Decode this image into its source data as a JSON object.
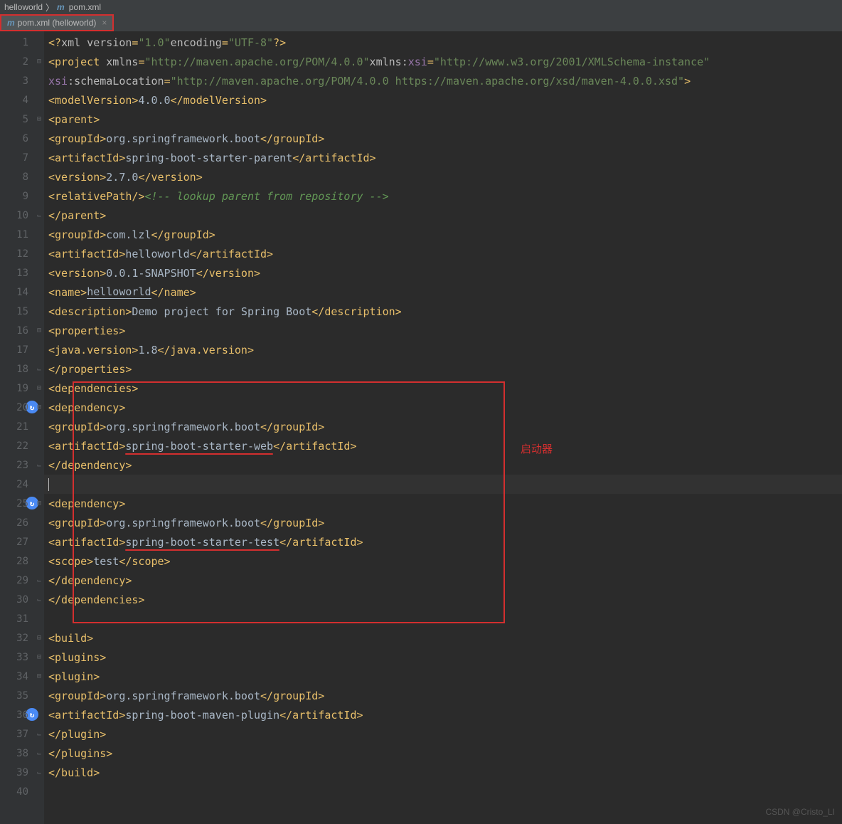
{
  "breadcrumb": {
    "project": "helloworld",
    "file": "pom.xml"
  },
  "tab": {
    "label": "pom.xml (helloworld)"
  },
  "annotation": "启动器",
  "watermark": "CSDN @Cristo_LI",
  "lines": [
    {
      "n": 1,
      "html": "<span class='tag'>&lt;?</span><span class='attr'>xml version</span><span class='tag'>=</span><span class='str'>\"1.0\"</span> <span class='attr'>encoding</span><span class='tag'>=</span><span class='str'>\"UTF-8\"</span><span class='tag'>?&gt;</span>"
    },
    {
      "n": 2,
      "html": "<span class='tag'>&lt;project </span><span class='attr'>xmlns</span><span class='tag'>=</span><span class='str'>\"http://maven.apache.org/POM/4.0.0\"</span> <span class='attr'>xmlns:</span><span class='ns'>xsi</span><span class='tag'>=</span><span class='str'>\"http://www.w3.org/2001/XMLSchema-instance\"</span>"
    },
    {
      "n": 3,
      "html": "         <span class='ns'>xsi</span><span class='attr'>:schemaLocation</span><span class='tag'>=</span><span class='str'>\"http://maven.apache.org/POM/4.0.0 https://maven.apache.org/xsd/maven-4.0.0.xsd\"</span><span class='tag'>&gt;</span>"
    },
    {
      "n": 4,
      "html": "    <span class='tag'>&lt;modelVersion&gt;</span><span class='txt'>4.0.0</span><span class='tag'>&lt;/modelVersion&gt;</span>"
    },
    {
      "n": 5,
      "html": "    <span class='tag'>&lt;parent&gt;</span>"
    },
    {
      "n": 6,
      "html": "        <span class='tag'>&lt;groupId&gt;</span><span class='txt'>org.springframework.boot</span><span class='tag'>&lt;/groupId&gt;</span>"
    },
    {
      "n": 7,
      "html": "        <span class='tag'>&lt;artifactId&gt;</span><span class='txt'>spring-boot-starter-parent</span><span class='tag'>&lt;/artifactId&gt;</span>"
    },
    {
      "n": 8,
      "html": "        <span class='tag'>&lt;version&gt;</span><span class='txt'>2.7.0</span><span class='tag'>&lt;/version&gt;</span>"
    },
    {
      "n": 9,
      "html": "        <span class='tag'>&lt;relativePath/&gt;</span> <span class='comment'>&lt;!-- lookup parent from repository --&gt;</span>"
    },
    {
      "n": 10,
      "html": "    <span class='tag'>&lt;/parent&gt;</span>"
    },
    {
      "n": 11,
      "html": "    <span class='tag'>&lt;groupId&gt;</span><span class='txt'>com.lzl</span><span class='tag'>&lt;/groupId&gt;</span>"
    },
    {
      "n": 12,
      "html": "    <span class='tag'>&lt;artifactId&gt;</span><span class='txt'>helloworld</span><span class='tag'>&lt;/artifactId&gt;</span>"
    },
    {
      "n": 13,
      "html": "    <span class='tag'>&lt;version&gt;</span><span class='txt'>0.0.1-SNAPSHOT</span><span class='tag'>&lt;/version&gt;</span>"
    },
    {
      "n": 14,
      "html": "    <span class='tag'>&lt;name&gt;</span><span class='txt underline-link'>helloworld</span><span class='tag'>&lt;/name&gt;</span>"
    },
    {
      "n": 15,
      "html": "    <span class='tag'>&lt;description&gt;</span><span class='txt'>Demo project for Spring Boot</span><span class='tag'>&lt;/description&gt;</span>"
    },
    {
      "n": 16,
      "html": "    <span class='tag'>&lt;properties&gt;</span>"
    },
    {
      "n": 17,
      "html": "        <span class='tag'>&lt;java.version&gt;</span><span class='txt'>1.8</span><span class='tag'>&lt;/java.version&gt;</span>"
    },
    {
      "n": 18,
      "html": "    <span class='tag'>&lt;/properties&gt;</span>"
    },
    {
      "n": 19,
      "html": "    <span class='tag'>&lt;dependencies&gt;</span>"
    },
    {
      "n": 20,
      "html": "        <span class='tag'>&lt;dependency&gt;</span>",
      "icon": true
    },
    {
      "n": 21,
      "html": "            <span class='tag'>&lt;groupId&gt;</span><span class='txt'>org.springframework.boot</span><span class='tag'>&lt;/groupId&gt;</span>"
    },
    {
      "n": 22,
      "html": "            <span class='tag'>&lt;artifactId&gt;</span><span class='txt red-underline'>spring-boot-starter-web</span><span class='tag'>&lt;/artifactId&gt;</span>"
    },
    {
      "n": 23,
      "html": "        <span class='tag'>&lt;/dependency&gt;</span>"
    },
    {
      "n": 24,
      "html": "<span class='caret'></span>",
      "current": true
    },
    {
      "n": 25,
      "html": "        <span class='tag'>&lt;dependency&gt;</span>",
      "icon": true
    },
    {
      "n": 26,
      "html": "            <span class='tag'>&lt;groupId&gt;</span><span class='txt'>org.springframework.boot</span><span class='tag'>&lt;/groupId&gt;</span>"
    },
    {
      "n": 27,
      "html": "            <span class='tag'>&lt;artifactId&gt;</span><span class='txt red-underline'>spring-boot-starter-test</span><span class='tag'>&lt;/artifactId&gt;</span>"
    },
    {
      "n": 28,
      "html": "            <span class='tag'>&lt;scope&gt;</span><span class='txt'>test</span><span class='tag'>&lt;/scope&gt;</span>"
    },
    {
      "n": 29,
      "html": "        <span class='tag'>&lt;/dependency&gt;</span>"
    },
    {
      "n": 30,
      "html": "    <span class='tag'>&lt;/dependencies&gt;</span>"
    },
    {
      "n": 31,
      "html": ""
    },
    {
      "n": 32,
      "html": "    <span class='tag'>&lt;build&gt;</span>"
    },
    {
      "n": 33,
      "html": "        <span class='tag'>&lt;plugins&gt;</span>"
    },
    {
      "n": 34,
      "html": "            <span class='tag'>&lt;plugin&gt;</span>"
    },
    {
      "n": 35,
      "html": "                <span class='tag'>&lt;groupId&gt;</span><span class='txt'>org.springframework.boot</span><span class='tag'>&lt;/groupId&gt;</span>"
    },
    {
      "n": 36,
      "html": "                <span class='tag'>&lt;artifactId&gt;</span><span class='txt'>spring-boot-maven-plugin</span><span class='tag'>&lt;/artifactId&gt;</span>",
      "icon": true
    },
    {
      "n": 37,
      "html": "            <span class='tag'>&lt;/plugin&gt;</span>"
    },
    {
      "n": 38,
      "html": "        <span class='tag'>&lt;/plugins&gt;</span>"
    },
    {
      "n": 39,
      "html": "    <span class='tag'>&lt;/build&gt;</span>"
    },
    {
      "n": 40,
      "html": ""
    }
  ]
}
